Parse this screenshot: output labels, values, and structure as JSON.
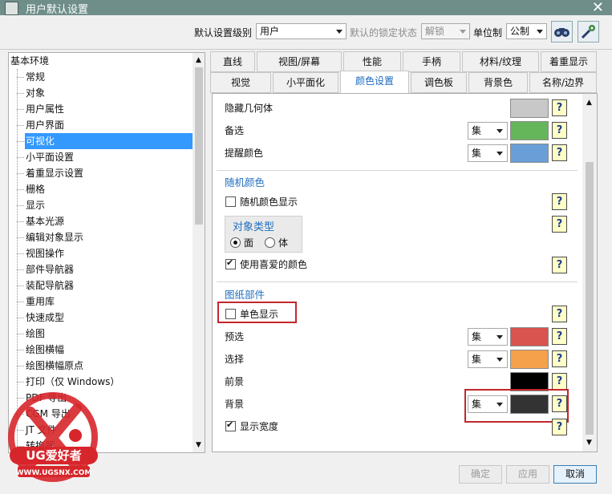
{
  "window": {
    "title": "用户默认设置",
    "close_glyph": "✕"
  },
  "topbar": {
    "level_label": "默认设置级别",
    "level_value": "用户",
    "lock_label": "默认的锁定状态",
    "lock_value": "解锁",
    "unit_label": "单位制",
    "unit_value": "公制"
  },
  "tree": {
    "root": "基本环境",
    "items": [
      "常规",
      "对象",
      "用户属性",
      "用户界面",
      "可视化",
      "小平面设置",
      "着重显示设置",
      "栅格",
      "显示",
      "基本光源",
      "编辑对象显示",
      "视图操作",
      "部件导航器",
      "装配导航器",
      "重用库",
      "快速成型",
      "绘图",
      "绘图横幅",
      "绘图横幅原点",
      "打印（仅 Windows）",
      "PDF 导出",
      "CGM 导出",
      "JT 文件",
      "转换器"
    ],
    "selected_index": 4
  },
  "tabs": {
    "row1": [
      "直线",
      "视图/屏幕",
      "性能",
      "手柄",
      "材料/纹理",
      "着重显示"
    ],
    "row2": [
      "视觉",
      "小平面化",
      "颜色设置",
      "调色板",
      "背景色",
      "名称/边界"
    ],
    "active": "颜色设置"
  },
  "panel": {
    "hidden_geometry": {
      "label": "隐藏几何体",
      "color": "#c8c8c8"
    },
    "preselection": {
      "label": "备选",
      "mode": "集",
      "color": "#65b65b"
    },
    "reminder": {
      "label": "提醒颜色",
      "mode": "集",
      "color": "#6a9ed6"
    },
    "random_section": {
      "title": "随机颜色",
      "random_display": {
        "label": "随机颜色显示",
        "checked": false
      },
      "object_type": {
        "title": "对象类型",
        "options": [
          "面",
          "体"
        ],
        "selected": "面"
      },
      "use_favorite": {
        "label": "使用喜爱的颜色",
        "checked": true
      }
    },
    "drawing_section": {
      "title": "图纸部件",
      "monochrome": {
        "label": "单色显示",
        "checked": false
      },
      "preselect": {
        "label": "预选",
        "mode": "集",
        "color": "#d9534f"
      },
      "select": {
        "label": "选择",
        "mode": "集",
        "color": "#f5a04a"
      },
      "foreground": {
        "label": "前景",
        "color": "#000000"
      },
      "background": {
        "label": "背景",
        "mode": "集",
        "color": "#333333"
      },
      "show_width": {
        "label": "显示宽度",
        "checked": true
      }
    },
    "help_glyph": "?"
  },
  "buttons": {
    "ok": "确定",
    "apply": "应用",
    "cancel": "取消"
  },
  "watermark": {
    "brand": "UG爱好者",
    "url": "WWW.UGSNX.COM"
  },
  "colors": {
    "accent": "#3399ff",
    "title_bar": "#6f8e8a",
    "highlight_border": "#c1272d",
    "watermark_red": "#d7262b"
  }
}
